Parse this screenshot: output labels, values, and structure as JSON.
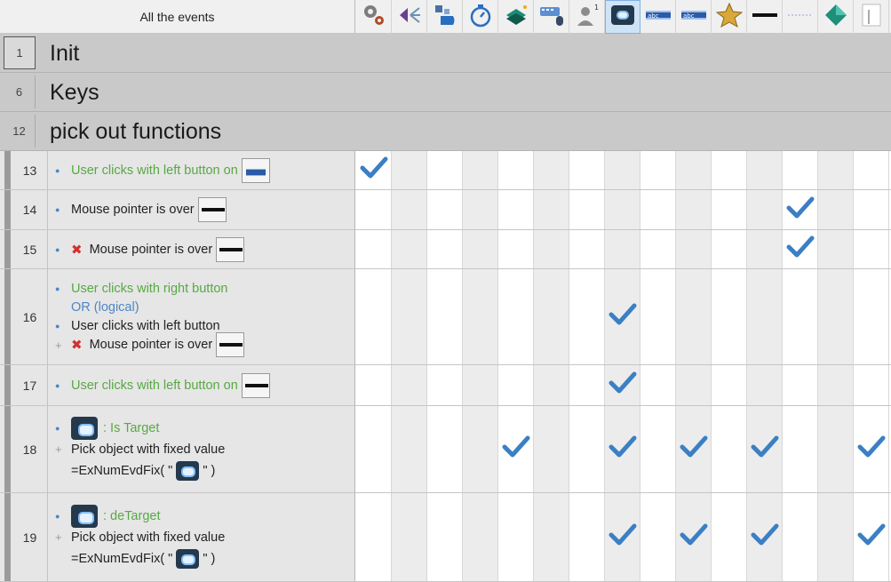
{
  "header": {
    "title": "All the events",
    "columns": [
      {
        "icon": "gears-icon"
      },
      {
        "icon": "speaker-arrows-icon"
      },
      {
        "icon": "puzzle-pieces-icon"
      },
      {
        "icon": "stopwatch-icon"
      },
      {
        "icon": "layers-sparkle-icon"
      },
      {
        "icon": "keyboard-mouse-icon"
      },
      {
        "icon": "player-1-icon"
      },
      {
        "icon": "target-badge-icon",
        "selected": true
      },
      {
        "icon": "text-abc-icon"
      },
      {
        "icon": "text-abc-icon-2"
      },
      {
        "icon": "star-icon"
      },
      {
        "icon": "black-bar-icon"
      },
      {
        "icon": "dashed-line-icon"
      },
      {
        "icon": "green-diamond-icon"
      },
      {
        "icon": "partial-thumbnail-icon"
      }
    ]
  },
  "groups": [
    {
      "num": "1",
      "label": "Init"
    },
    {
      "num": "6",
      "label": "Keys"
    },
    {
      "num": "12",
      "label": "pick out functions"
    }
  ],
  "events": [
    {
      "num": "13",
      "lines": [
        {
          "lead": "bullet",
          "text": "User clicks with left button on",
          "color": "green",
          "obj": "abc"
        }
      ],
      "checks": [
        0
      ]
    },
    {
      "num": "14",
      "lines": [
        {
          "lead": "bullet",
          "text": "Mouse pointer is over",
          "color": "dark",
          "obj": "bar"
        }
      ],
      "checks": [
        12
      ]
    },
    {
      "num": "15",
      "lines": [
        {
          "lead": "bullet",
          "negated": true,
          "text": "Mouse pointer is over",
          "color": "dark",
          "obj": "bar"
        }
      ],
      "checks": [
        12
      ]
    },
    {
      "num": "16",
      "lines": [
        {
          "lead": "bullet",
          "text": "User clicks with right button",
          "color": "green"
        },
        {
          "lead": "none",
          "text": "OR (logical)",
          "color": "blue"
        },
        {
          "lead": "bullet",
          "text": "User clicks with left button",
          "color": "dark"
        },
        {
          "lead": "plus",
          "negated": true,
          "text": "Mouse pointer is over",
          "color": "dark",
          "obj": "bar"
        }
      ],
      "checks": [
        7
      ]
    },
    {
      "num": "17",
      "lines": [
        {
          "lead": "bullet",
          "text": "User clicks with left button on",
          "color": "green",
          "obj": "bar"
        }
      ],
      "checks": [
        7
      ]
    },
    {
      "num": "18",
      "lines": [
        {
          "lead": "bullet",
          "badge": true,
          "text": ": Is Target",
          "color": "green"
        },
        {
          "lead": "plus",
          "text": "Pick object with fixed value",
          "color": "dark"
        },
        {
          "lead": "none",
          "text": "=ExNumEvdFix( \"",
          "text2": "\" )",
          "inlineBadge": true,
          "color": "dark"
        }
      ],
      "checks": [
        4,
        7,
        9,
        11,
        14
      ]
    },
    {
      "num": "19",
      "lines": [
        {
          "lead": "bullet",
          "badge": true,
          "text": ": deTarget",
          "color": "green"
        },
        {
          "lead": "plus",
          "text": "Pick object with fixed value",
          "color": "dark"
        },
        {
          "lead": "none",
          "text": "=ExNumEvdFix( \"",
          "text2": "\" )",
          "inlineBadge": true,
          "color": "dark"
        }
      ],
      "checks": [
        7,
        9,
        11,
        14
      ]
    }
  ],
  "colors": {
    "check": "#3b7fc4",
    "green_text": "#58a843",
    "group_bg": "#c9c9c9",
    "selected_col": "#cfe3f7"
  }
}
